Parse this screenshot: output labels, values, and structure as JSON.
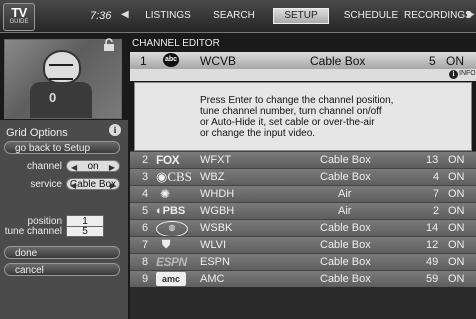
{
  "header": {
    "logo_top": "TV",
    "logo_bottom": "GUIDE",
    "clock": "7:36",
    "nav_left_icon": "triangle-left",
    "nav_right_icon": "triangle-right",
    "tabs": [
      {
        "label": "LISTINGS",
        "selected": false
      },
      {
        "label": "SEARCH",
        "selected": false
      },
      {
        "label": "SETUP",
        "selected": true
      },
      {
        "label": "SCHEDULE",
        "selected": false
      },
      {
        "label": "RECORDINGS",
        "selected": false
      }
    ]
  },
  "preview": {
    "lock_icon": "lock-icon",
    "jersey_number": "0"
  },
  "grid_options": {
    "title": "Grid Options",
    "info_icon": "i",
    "go_back": "go back to Setup",
    "channel_label": "channel",
    "channel_value": "on",
    "service_label": "service",
    "service_value": "Cable Box",
    "tune_label": "tune channel",
    "tune_value": "5",
    "position_label": "position",
    "position_value": "1",
    "done": "done",
    "cancel": "cancel"
  },
  "editor": {
    "title": "CHANNEL EDITOR",
    "selected": {
      "pos": "1",
      "logo": "abc",
      "call": "WCVB",
      "service": "Cable Box",
      "channel": "5",
      "state": "ON"
    },
    "info_icon": "i",
    "info_label": "INFO",
    "help": "Press Enter to change the channel position,\ntune channel number, turn channel on/off\nor Auto-Hide it, set cable or over-the-air\nor change the input video.",
    "rows": [
      {
        "pos": "2",
        "logo": "FOX",
        "call": "WFXT",
        "service": "Cable Box",
        "channel": "13",
        "state": "ON"
      },
      {
        "pos": "3",
        "logo": "CBS",
        "call": "WBZ",
        "service": "Cable Box",
        "channel": "4",
        "state": "ON"
      },
      {
        "pos": "4",
        "logo": "NBC",
        "call": "WHDH",
        "service": "Air",
        "channel": "7",
        "state": "ON"
      },
      {
        "pos": "5",
        "logo": "PBS",
        "call": "WGBH",
        "service": "Air",
        "channel": "2",
        "state": "ON"
      },
      {
        "pos": "6",
        "logo": "UPN",
        "call": "WSBK",
        "service": "Cable Box",
        "channel": "14",
        "state": "ON"
      },
      {
        "pos": "7",
        "logo": "WB",
        "call": "WLVI",
        "service": "Cable Box",
        "channel": "12",
        "state": "ON"
      },
      {
        "pos": "8",
        "logo": "ESPN",
        "call": "ESPN",
        "service": "Cable Box",
        "channel": "49",
        "state": "ON"
      },
      {
        "pos": "9",
        "logo": "amc",
        "call": "AMC",
        "service": "Cable Box",
        "channel": "59",
        "state": "ON"
      }
    ]
  }
}
